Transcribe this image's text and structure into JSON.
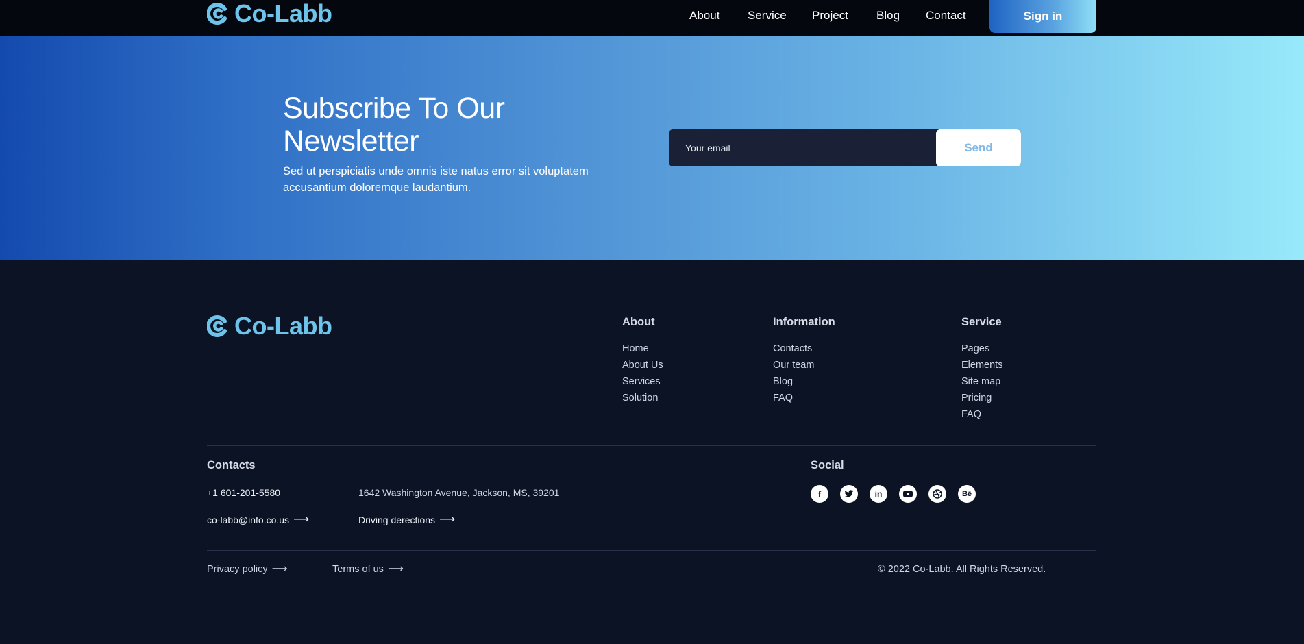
{
  "brand": {
    "name": "Co-Labb",
    "logo_icon": "c-mark-logo-icon",
    "color": "#6ec3ea"
  },
  "header": {
    "nav": [
      {
        "label": "About"
      },
      {
        "label": "Service"
      },
      {
        "label": "Project"
      },
      {
        "label": "Blog"
      },
      {
        "label": "Contact"
      }
    ],
    "signin_label": "Sign in"
  },
  "newsletter": {
    "title": "Subscribe To Our Newsletter",
    "description": "Sed ut perspiciatis unde omnis iste natus error sit voluptatem accusantium doloremque laudantium.",
    "email_placeholder": "Your email",
    "send_label": "Send"
  },
  "footer": {
    "columns": [
      {
        "heading": "About",
        "links": [
          "Home",
          "About Us",
          "Services",
          "Solution"
        ]
      },
      {
        "heading": "Information",
        "links": [
          "Contacts",
          "Our team",
          "Blog",
          "FAQ"
        ]
      },
      {
        "heading": "Service",
        "links": [
          "Pages",
          "Elements",
          "Site map",
          "Pricing",
          "FAQ"
        ]
      }
    ],
    "contacts": {
      "heading": "Contacts",
      "phone": "+1 601-201-5580",
      "address": "1642 Washington Avenue, Jackson, MS, 39201",
      "email": "co-labb@info.co.us",
      "directions": "Driving derections"
    },
    "social": {
      "heading": "Social",
      "icons": [
        "facebook-icon",
        "twitter-icon",
        "linkedin-icon",
        "youtube-icon",
        "dribbble-icon",
        "behance-icon"
      ]
    },
    "legal": {
      "privacy": "Privacy policy",
      "terms": "Terms of us",
      "copyright": "© 2022 Co-Labb. All Rights Reserved."
    }
  }
}
